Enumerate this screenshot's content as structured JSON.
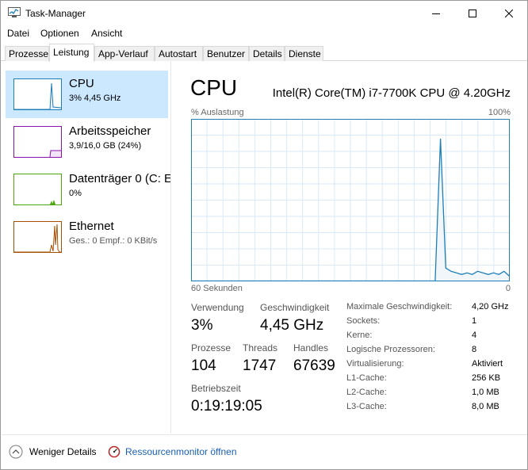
{
  "window": {
    "title": "Task-Manager"
  },
  "menu": [
    "Datei",
    "Optionen",
    "Ansicht"
  ],
  "tabs": [
    {
      "label": "Prozesse",
      "active": false
    },
    {
      "label": "Leistung",
      "active": true
    },
    {
      "label": "App-Verlauf",
      "active": false
    },
    {
      "label": "Autostart",
      "active": false
    },
    {
      "label": "Benutzer",
      "active": false
    },
    {
      "label": "Details",
      "active": false
    },
    {
      "label": "Dienste",
      "active": false
    }
  ],
  "sidebar": {
    "items": [
      {
        "name": "CPU",
        "sub": "3%  4,45 GHz",
        "selected": true,
        "color": "#1e7fb8"
      },
      {
        "name": "Arbeitsspeicher",
        "sub": "3,9/16,0 GB (24%)",
        "selected": false,
        "color": "#8b12ae"
      },
      {
        "name": "Datenträger 0 (C: E",
        "sub": "0%",
        "selected": false,
        "color": "#4da60c"
      },
      {
        "name": "Ethernet",
        "sub": "Ges.: 0 Empf.: 0 KBit/s",
        "selected": false,
        "color": "#a74f01"
      }
    ]
  },
  "main": {
    "title": "CPU",
    "model": "Intel(R) Core(TM) i7-7700K CPU @ 4.20GHz",
    "graph": {
      "label": "% Auslastung",
      "max_label": "100%",
      "time_label": "60 Sekunden",
      "min_label": "0",
      "line_color": "#1e7fb8",
      "grid_color": "#d9eaf7",
      "fill_color": "#f1f6fa",
      "usage_percent": [
        0,
        0,
        0,
        0,
        0,
        0,
        0,
        0,
        0,
        0,
        0,
        0,
        0,
        0,
        0,
        0,
        0,
        0,
        0,
        0,
        0,
        0,
        0,
        0,
        0,
        0,
        0,
        0,
        0,
        0,
        0,
        0,
        0,
        0,
        0,
        0,
        0,
        0,
        0,
        0,
        0,
        0,
        0,
        0,
        0,
        0,
        0,
        88,
        8,
        6,
        5,
        4,
        5,
        4,
        6,
        5,
        4,
        5,
        4,
        6,
        3
      ]
    },
    "stats": {
      "usage_label": "Verwendung",
      "usage_value": "3%",
      "speed_label": "Geschwindigkeit",
      "speed_value": "4,45 GHz",
      "processes_label": "Prozesse",
      "processes_value": "104",
      "threads_label": "Threads",
      "threads_value": "1747",
      "handles_label": "Handles",
      "handles_value": "67639",
      "uptime_label": "Betriebszeit",
      "uptime_value": "0:19:19:05"
    },
    "details": [
      {
        "label": "Maximale Geschwindigkeit:",
        "value": "4,20 GHz"
      },
      {
        "label": "Sockets:",
        "value": "1"
      },
      {
        "label": "Kerne:",
        "value": "4"
      },
      {
        "label": "Logische Prozessoren:",
        "value": "8"
      },
      {
        "label": "Virtualisierung:",
        "value": "Aktiviert"
      },
      {
        "label": "L1-Cache:",
        "value": "256 KB"
      },
      {
        "label": "L2-Cache:",
        "value": "1,0 MB"
      },
      {
        "label": "L3-Cache:",
        "value": "8,0 MB"
      }
    ]
  },
  "footer": {
    "fewer_details": "Weniger Details",
    "resource_monitor": "Ressourcenmonitor öffnen"
  }
}
